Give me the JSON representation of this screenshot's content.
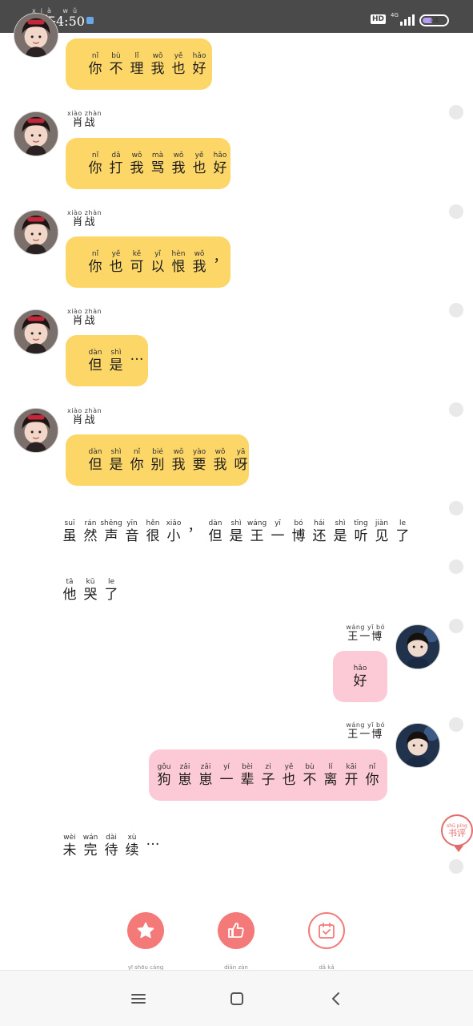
{
  "status_bar": {
    "time_pinyin": "xià wǔ",
    "time": "下午4:50",
    "hd": "HD",
    "network": "4G",
    "battery_text": "44"
  },
  "characters": {
    "xiao_zhan": {
      "name": "肖战",
      "pinyin": "xiào zhàn"
    },
    "wang_yibo": {
      "name": "王一博",
      "pinyin": "wáng yī bó"
    }
  },
  "messages": [
    {
      "speaker": "肖战",
      "side": "left",
      "chars": [
        [
          "nǐ",
          "你"
        ],
        [
          "bù",
          "不"
        ],
        [
          "lǐ",
          "理"
        ],
        [
          "wǒ",
          "我"
        ],
        [
          "yě",
          "也"
        ],
        [
          "hǎo",
          "好"
        ]
      ]
    },
    {
      "speaker": "肖战",
      "side": "left",
      "chars": [
        [
          "nǐ",
          "你"
        ],
        [
          "dǎ",
          "打"
        ],
        [
          "wǒ",
          "我"
        ],
        [
          "mà",
          "骂"
        ],
        [
          "wǒ",
          "我"
        ],
        [
          "yě",
          "也"
        ],
        [
          "hǎo",
          "好"
        ]
      ]
    },
    {
      "speaker": "肖战",
      "side": "left",
      "chars": [
        [
          "nǐ",
          "你"
        ],
        [
          "yě",
          "也"
        ],
        [
          "kě",
          "可"
        ],
        [
          "yǐ",
          "以"
        ],
        [
          "hèn",
          "恨"
        ],
        [
          "wǒ",
          "我"
        ],
        [
          "",
          "，"
        ]
      ]
    },
    {
      "speaker": "肖战",
      "side": "left",
      "chars": [
        [
          "dàn",
          "但"
        ],
        [
          "shì",
          "是"
        ],
        [
          "",
          "…"
        ]
      ]
    },
    {
      "speaker": "肖战",
      "side": "left",
      "chars": [
        [
          "dàn",
          "但"
        ],
        [
          "shì",
          "是"
        ],
        [
          "nǐ",
          "你"
        ],
        [
          "bié",
          "别"
        ],
        [
          "wǒ",
          "我"
        ],
        [
          "yào",
          "要"
        ],
        [
          "wǒ",
          "我"
        ],
        [
          "yā",
          "呀"
        ]
      ]
    },
    {
      "speaker": "",
      "side": "narration",
      "chars": [
        [
          "suī",
          "虽"
        ],
        [
          "rán",
          "然"
        ],
        [
          "shēng",
          "声"
        ],
        [
          "yīn",
          "音"
        ],
        [
          "hěn",
          "很"
        ],
        [
          "xiǎo",
          "小"
        ],
        [
          "",
          "，"
        ],
        [
          "dàn",
          "但"
        ],
        [
          "shì",
          "是"
        ],
        [
          "wáng",
          "王"
        ],
        [
          "yī",
          "一"
        ],
        [
          "bó",
          "博"
        ],
        [
          "hái",
          "还"
        ],
        [
          "shì",
          "是"
        ],
        [
          "tīng",
          "听"
        ],
        [
          "jiàn",
          "见"
        ],
        [
          "le",
          "了"
        ]
      ]
    },
    {
      "speaker": "",
      "side": "narration",
      "chars": [
        [
          "tā",
          "他"
        ],
        [
          "kū",
          "哭"
        ],
        [
          "le",
          "了"
        ]
      ]
    },
    {
      "speaker": "王一博",
      "side": "right",
      "chars": [
        [
          "hǎo",
          "好"
        ]
      ]
    },
    {
      "speaker": "王一博",
      "side": "right",
      "chars": [
        [
          "gǒu",
          "狗"
        ],
        [
          "zǎi",
          "崽"
        ],
        [
          "zǎi",
          "崽"
        ],
        [
          "yí",
          "一"
        ],
        [
          "bèi",
          "辈"
        ],
        [
          "zi",
          "子"
        ],
        [
          "yě",
          "也"
        ],
        [
          "bù",
          "不"
        ],
        [
          "lí",
          "离"
        ],
        [
          "kāi",
          "开"
        ],
        [
          "nǐ",
          "你"
        ]
      ]
    },
    {
      "speaker": "",
      "side": "narration",
      "chars": [
        [
          "wèi",
          "未"
        ],
        [
          "wán",
          "完"
        ],
        [
          "dài",
          "待"
        ],
        [
          "xù",
          "续"
        ],
        [
          "",
          "…"
        ]
      ]
    }
  ],
  "float_badge": {
    "pinyin": "shū píng",
    "label": "书评"
  },
  "actions": [
    {
      "name": "favorite",
      "label": "yī shōu cáng",
      "icon": "star-icon"
    },
    {
      "name": "like",
      "label": "diǎn zàn",
      "icon": "thumbs-up-icon"
    },
    {
      "name": "checkin",
      "label": "dǎ kǎ",
      "icon": "calendar-check-icon"
    }
  ],
  "nav": {
    "menu": "menu-icon",
    "home": "home-icon",
    "back": "back-icon"
  },
  "colors": {
    "left_bubble": "#fdd668",
    "right_bubble": "#fcc9d6",
    "accent": "#f47a7a",
    "status_bar": "#4a4a4a"
  }
}
